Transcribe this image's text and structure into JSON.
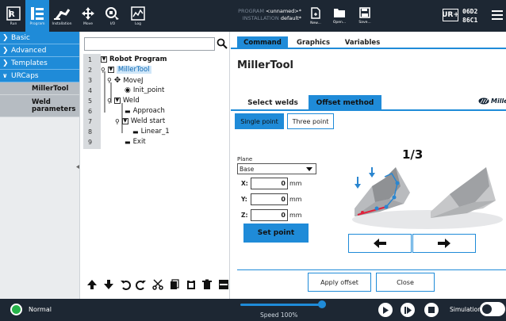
{
  "topbar": {
    "buttons": [
      {
        "label": "Run",
        "icon": "ur-run-icon"
      },
      {
        "label": "Program",
        "icon": "program-icon"
      },
      {
        "label": "Installation",
        "icon": "installation-icon"
      },
      {
        "label": "Move",
        "icon": "move-icon"
      },
      {
        "label": "I/O",
        "icon": "io-icon"
      },
      {
        "label": "Log",
        "icon": "log-icon"
      }
    ],
    "program_key": "PROGRAM",
    "program_value": "<unnamed>*",
    "installation_key": "INSTALLATION",
    "installation_value": "default*",
    "file_buttons": [
      {
        "label": "New...",
        "icon": "new-file-icon"
      },
      {
        "label": "Open...",
        "icon": "open-folder-icon"
      },
      {
        "label": "Save...",
        "icon": "save-icon"
      }
    ],
    "ur_badge": "UR+",
    "serial_line1": "06D2",
    "serial_line2": "86C1"
  },
  "leftnav": {
    "items": [
      {
        "label": "Basic"
      },
      {
        "label": "Advanced"
      },
      {
        "label": "Templates"
      },
      {
        "label": "URCaps"
      }
    ],
    "sub_items": [
      {
        "label": "MillerTool"
      },
      {
        "label": "Weld parameters"
      }
    ]
  },
  "tree": {
    "line_numbers": [
      "1",
      "2",
      "3",
      "4",
      "5",
      "6",
      "7",
      "8",
      "9"
    ],
    "nodes": {
      "root": "Robot Program",
      "miller": "MillerTool",
      "movej": "MoveJ",
      "init": "Init_point",
      "weld": "Weld",
      "approach": "Approach",
      "weld_start": "Weld start",
      "linear": "Linear_1",
      "exit": "Exit"
    }
  },
  "right": {
    "tabs": [
      "Command",
      "Graphics",
      "Variables"
    ],
    "heading": "MillerTool",
    "inner_tabs": [
      "Select welds",
      "Offset method"
    ],
    "logo_text": "Miller",
    "method_buttons": [
      "Single point",
      "Three point"
    ],
    "plane_label": "Plane",
    "plane_value": "Base",
    "coords": [
      {
        "label": "X:",
        "value": "0",
        "unit": "mm"
      },
      {
        "label": "Y:",
        "value": "0",
        "unit": "mm"
      },
      {
        "label": "Z:",
        "value": "0",
        "unit": "mm"
      }
    ],
    "set_point": "Set point",
    "step": "1/3",
    "apply_offset": "Apply offset",
    "close": "Close"
  },
  "footer": {
    "status": "Normal",
    "speed": "Speed 100%",
    "speed_value": 1.0,
    "simulation": "Simulation"
  },
  "colors": {
    "accent": "#1f8bd8",
    "topbar": "#1d2733",
    "status_ok": "#27b34a"
  }
}
